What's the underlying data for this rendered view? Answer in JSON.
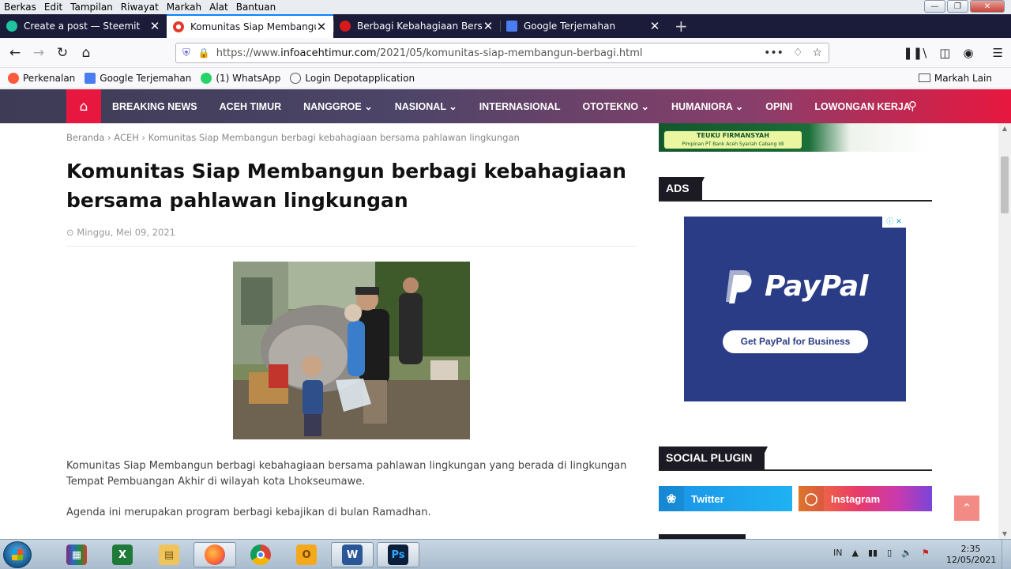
{
  "menu": [
    "Berkas",
    "Edit",
    "Tampilan",
    "Riwayat",
    "Markah",
    "Alat",
    "Bantuan"
  ],
  "tabs": [
    {
      "title": "Create a post — Steemit",
      "color": "#1ec5a0"
    },
    {
      "title": "Komunitas Siap Membangun b",
      "color": "#e23b2c",
      "active": true
    },
    {
      "title": "Berbagi Kebahagiaan Bersama",
      "color": "#d51a1a"
    },
    {
      "title": "Google Terjemahan",
      "color": "#4a7ef0"
    }
  ],
  "urlbar": {
    "prefix": "https://www.",
    "domain": "infoacehtimur.com",
    "path": "/2021/05/komunitas-siap-membangun-berbagi.html"
  },
  "bookmarks": [
    {
      "label": "Perkenalan",
      "color": "#ff5a3b"
    },
    {
      "label": "Google Terjemahan",
      "color": "#4a7ef0"
    },
    {
      "label": "(1) WhatsApp",
      "color": "#25d366"
    },
    {
      "label": "Login Depotapplication",
      "color": "#555555"
    }
  ],
  "bookmarks_right": "Markah Lain",
  "site_nav": [
    "BREAKING NEWS",
    "ACEH TIMUR",
    "NANGGROE ⌄",
    "NASIONAL ⌄",
    "INTERNASIONAL",
    "OTOTEKNO ⌄",
    "HUMANIORA ⌄",
    "OPINI",
    "LOWONGAN KERJA"
  ],
  "article": {
    "breadcrumb": "Beranda › ACEH › Komunitas Siap Membangun berbagi kebahagiaan bersama pahlawan lingkungan",
    "title": "Komunitas Siap Membangun berbagi kebahagiaan bersama pahlawan lingkungan",
    "date": "⊙ Minggu, Mei 09, 2021",
    "para1": "Komunitas Siap Membangun berbagi kebahagiaan bersama pahlawan lingkungan yang berada di lingkungan Tempat Pembuangan Akhir di wilayah kota Lhokseumawe.",
    "para2": "Agenda ini merupakan program berbagi kebajikan di bulan Ramadhan."
  },
  "sidebar": {
    "banner_name": "TEUKU FIRMANSYAH",
    "banner_sub": "Pimpinan PT Bank Aceh Syariah Cabang Idi",
    "ads_label": "ADS",
    "ad_brand": "PayPal",
    "ad_cta": "Get PayPal for Business",
    "social_label": "SOCIAL PLUGIN",
    "twitter": "Twitter",
    "instagram": "Instagram"
  },
  "taskbar": {
    "lang": "IN",
    "time": "2:35",
    "date": "12/05/2021"
  }
}
